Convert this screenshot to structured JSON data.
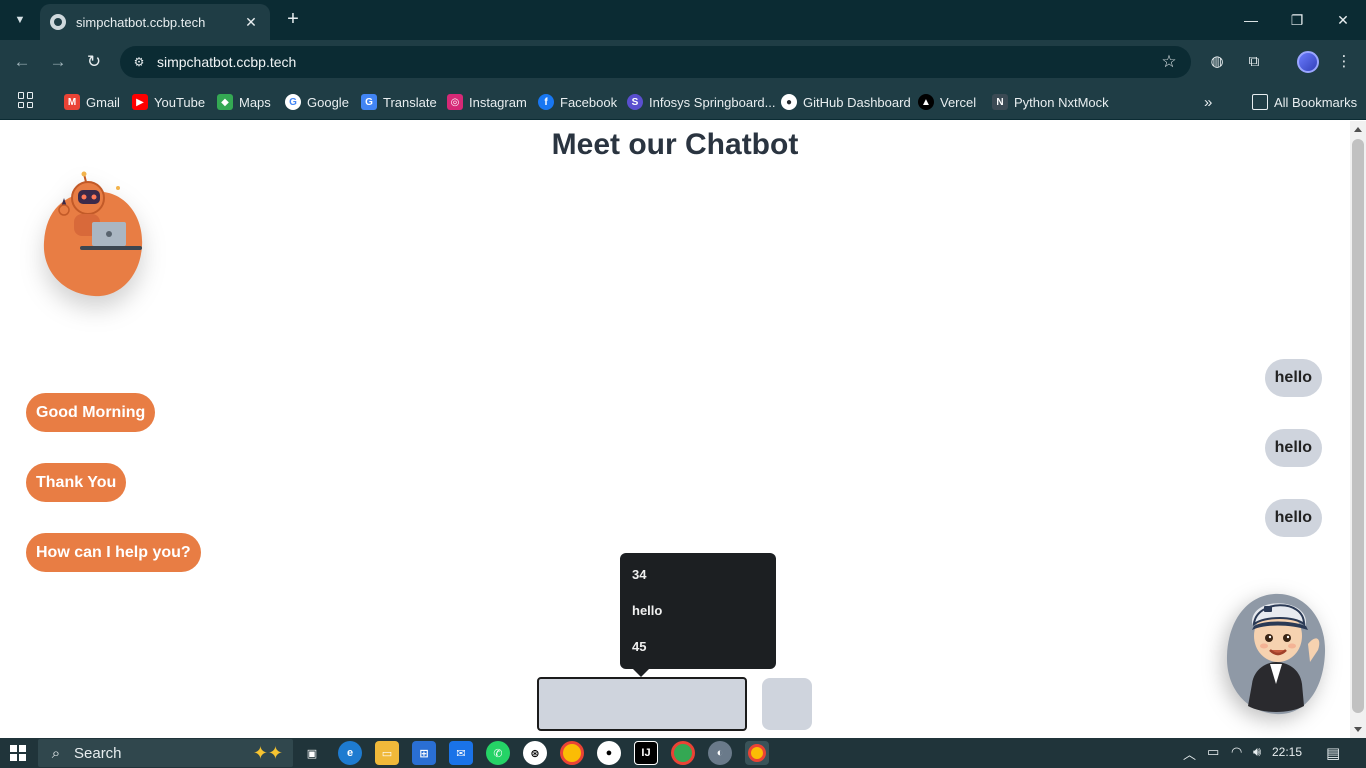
{
  "browser": {
    "tab_title": "simpchatbot.ccbp.tech",
    "url": "simpchatbot.ccbp.tech",
    "bookmarks": [
      {
        "label": "Gmail",
        "color": "#ea4335"
      },
      {
        "label": "YouTube",
        "color": "#ff0000"
      },
      {
        "label": "Maps",
        "color": "#34a853"
      },
      {
        "label": "Google",
        "color": "#4285f4"
      },
      {
        "label": "Translate",
        "color": "#4285f4"
      },
      {
        "label": "Instagram",
        "color": "#d62976"
      },
      {
        "label": "Facebook",
        "color": "#1877f2"
      },
      {
        "label": "Infosys Springboard...",
        "color": "#5a4fcf"
      },
      {
        "label": "GitHub Dashboard",
        "color": "#24292e"
      },
      {
        "label": "Vercel",
        "color": "#000000"
      },
      {
        "label": "Python NxtMock",
        "color": "#3b4a54"
      }
    ],
    "all_bookmarks": "All Bookmarks"
  },
  "page": {
    "title": "Meet our Chatbot"
  },
  "chat": {
    "user_messages": [
      "hello",
      "hello",
      "hello"
    ],
    "bot_messages": [
      "Good Morning",
      "Thank You",
      "How can I help you?"
    ],
    "input_value": "",
    "autocomplete": [
      "34",
      "hello",
      "45"
    ]
  },
  "taskbar": {
    "search_label": "Search",
    "time": "22:15"
  },
  "colors": {
    "bot_bubble": "#e87d44",
    "user_bubble": "#cfd4dd",
    "chrome_dark": "#0b2b33",
    "chrome": "#1f3d45"
  }
}
